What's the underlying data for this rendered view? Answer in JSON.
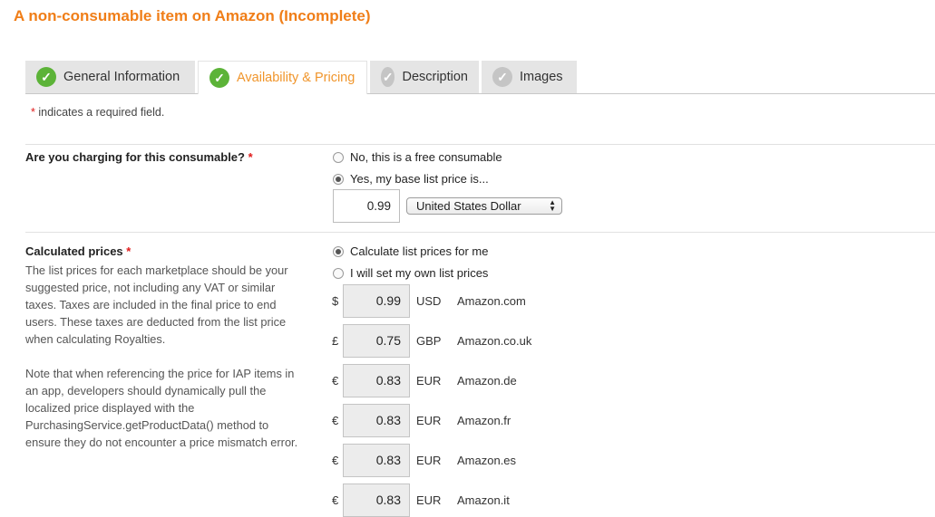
{
  "page_title": "A non-consumable item on Amazon (Incomplete)",
  "tabs": [
    {
      "label": "General Information",
      "status": "complete",
      "active": false
    },
    {
      "label": "Availability & Pricing",
      "status": "complete",
      "active": true
    },
    {
      "label": "Description",
      "status": "incomplete",
      "active": false
    },
    {
      "label": "Images",
      "status": "incomplete",
      "active": false
    }
  ],
  "colors": {
    "accent": "#f07e18",
    "check_done": "#5cb338",
    "check_todo": "#c5c5c5",
    "required": "#e01a1a"
  },
  "required_note": {
    "star": "*",
    "text": "indicates a required field."
  },
  "charging": {
    "label": "Are you charging for this consumable?",
    "options": [
      {
        "label": "No, this is a free consumable",
        "selected": false
      },
      {
        "label": "Yes, my base list price is...",
        "selected": true
      }
    ],
    "base_price": "0.99",
    "currency": "United States Dollar"
  },
  "calculated": {
    "label": "Calculated prices",
    "options": [
      {
        "label": "Calculate list prices for me",
        "selected": true
      },
      {
        "label": "I will set my own list prices",
        "selected": false
      }
    ],
    "description_lines": [
      "The list prices for each marketplace should be your",
      "suggested price, not including any VAT or similar",
      "taxes. Taxes are included in the final price to end",
      "users. These taxes are deducted from the list price",
      "when calculating Royalties."
    ],
    "note_lines": [
      "Note that when referencing the price for IAP items in",
      "an app, developers should dynamically pull the",
      "localized price displayed with the",
      "PurchasingService.getProductData() method to",
      "ensure they do not encounter a price mismatch error."
    ],
    "prices": [
      {
        "symbol": "$",
        "value": "0.99",
        "code": "USD",
        "store": "Amazon.com"
      },
      {
        "symbol": "£",
        "value": "0.75",
        "code": "GBP",
        "store": "Amazon.co.uk"
      },
      {
        "symbol": "€",
        "value": "0.83",
        "code": "EUR",
        "store": "Amazon.de"
      },
      {
        "symbol": "€",
        "value": "0.83",
        "code": "EUR",
        "store": "Amazon.fr"
      },
      {
        "symbol": "€",
        "value": "0.83",
        "code": "EUR",
        "store": "Amazon.es"
      },
      {
        "symbol": "€",
        "value": "0.83",
        "code": "EUR",
        "store": "Amazon.it"
      }
    ]
  }
}
